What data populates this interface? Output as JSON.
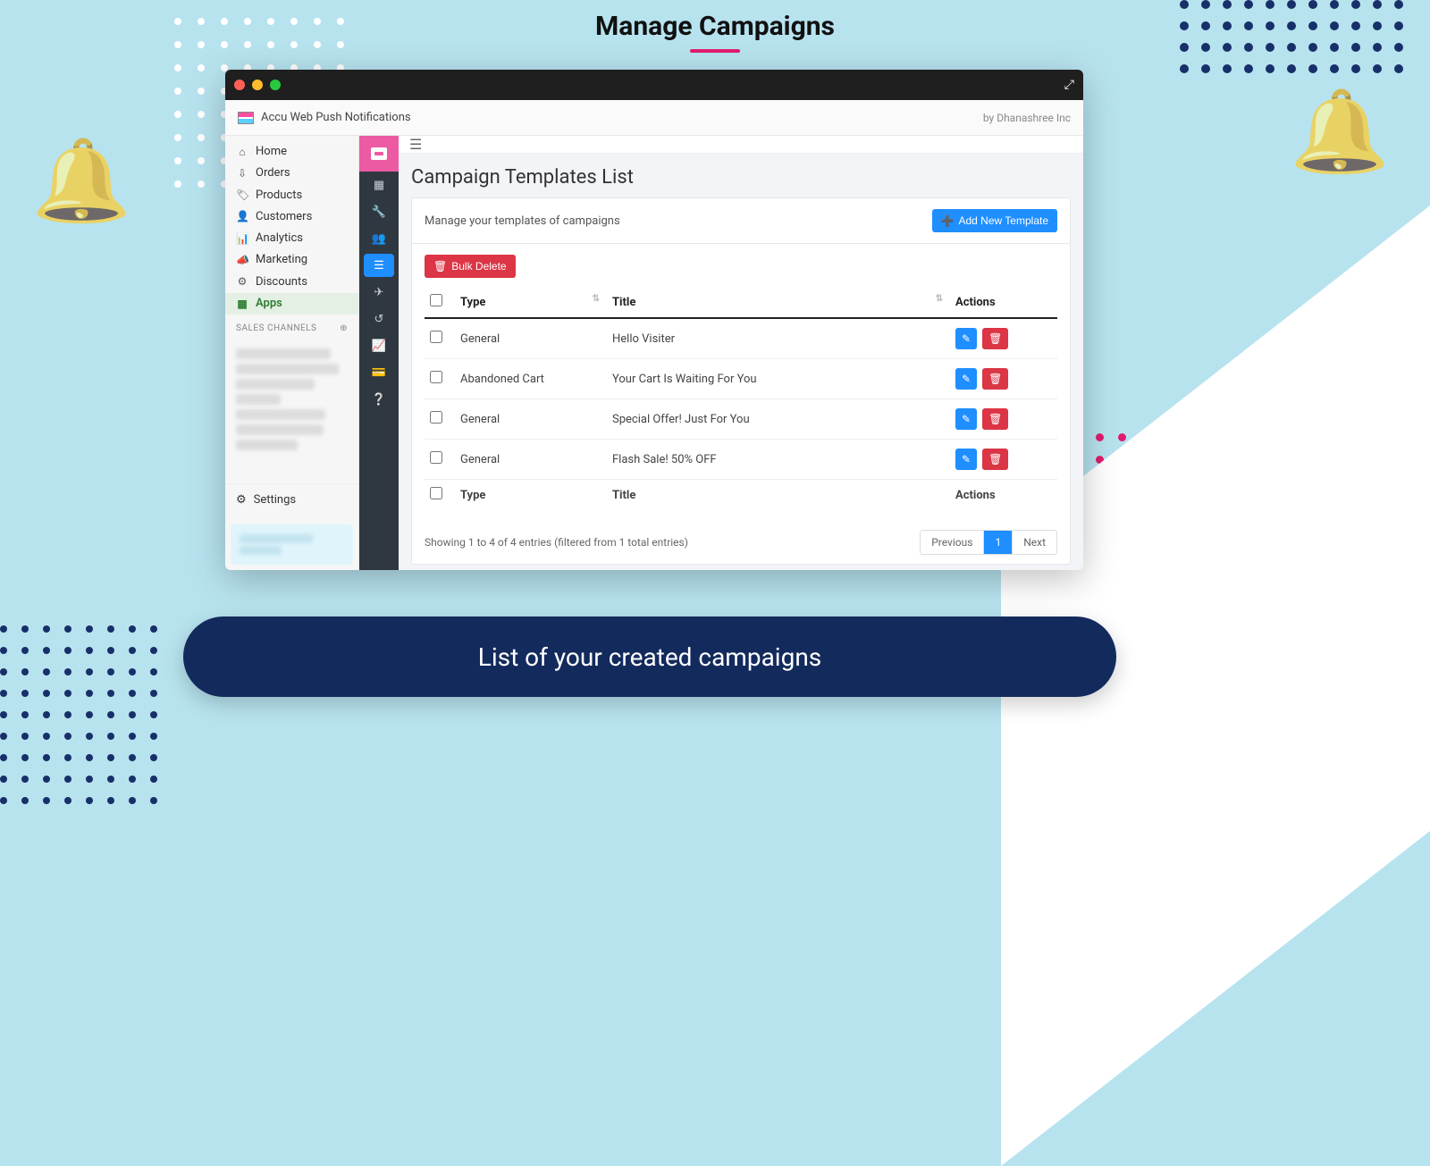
{
  "heading": "Manage Campaigns",
  "window": {
    "app_name": "Accu Web Push Notifications",
    "by": "by Dhanashree Inc"
  },
  "leftnav": {
    "items": [
      {
        "icon": "⌂",
        "label": "Home"
      },
      {
        "icon": "⇩",
        "label": "Orders"
      },
      {
        "icon": "🏷",
        "label": "Products"
      },
      {
        "icon": "👤",
        "label": "Customers"
      },
      {
        "icon": "📊",
        "label": "Analytics"
      },
      {
        "icon": "📣",
        "label": "Marketing"
      },
      {
        "icon": "⚙",
        "label": "Discounts"
      },
      {
        "icon": "▦",
        "label": "Apps",
        "active": true
      }
    ],
    "section": "SALES CHANNELS",
    "settings_icon": "⚙",
    "settings": "Settings"
  },
  "content": {
    "page_title": "Campaign Templates List",
    "subhead": "Manage your templates of campaigns",
    "add_btn": "Add New Template",
    "bulk_delete": "Bulk Delete",
    "headers": {
      "type": "Type",
      "title": "Title",
      "actions": "Actions"
    },
    "rows": [
      {
        "type": "General",
        "title": "Hello Visiter"
      },
      {
        "type": "Abandoned Cart",
        "title": "Your Cart Is Waiting For You"
      },
      {
        "type": "General",
        "title": "Special Offer! Just For You"
      },
      {
        "type": "General",
        "title": "Flash Sale! 50% OFF"
      }
    ],
    "footer_text": "Showing 1 to 4 of 4 entries (filtered from 1 total entries)",
    "pager": {
      "prev": "Previous",
      "page": "1",
      "next": "Next"
    }
  },
  "caption": "List of your created campaigns"
}
